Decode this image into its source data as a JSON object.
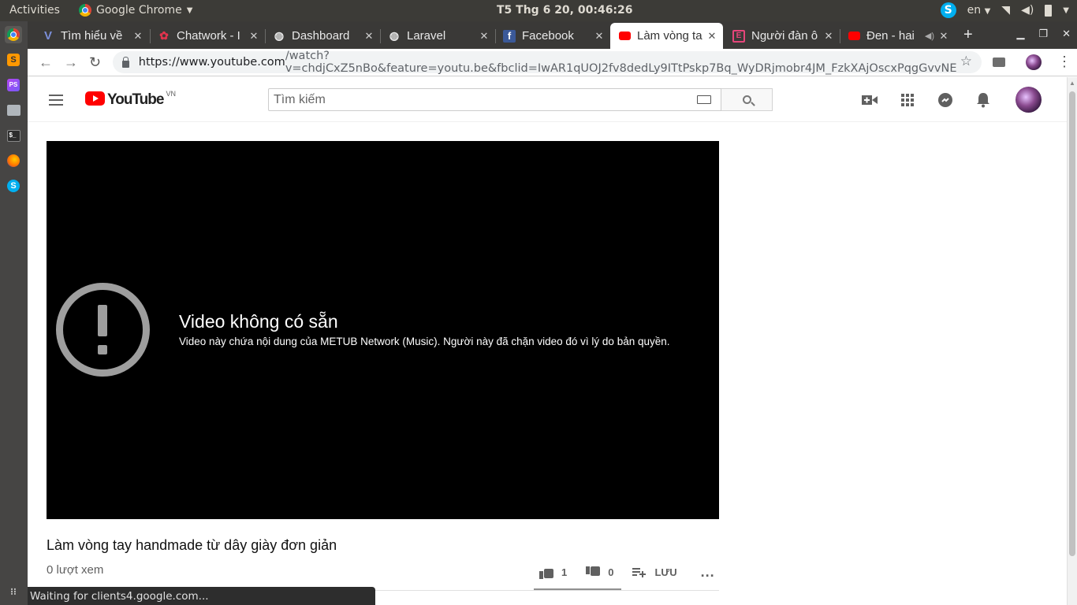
{
  "system": {
    "activities": "Activities",
    "app_name": "Google Chrome",
    "clock": "T5 Thg 6 20, 00:46:26",
    "keyboard_layout": "en"
  },
  "tabs": [
    {
      "label": "Tìm hiểu về",
      "icon": "v-icon",
      "active": false
    },
    {
      "label": "Chatwork - I",
      "icon": "chatwork-icon",
      "active": false
    },
    {
      "label": "Dashboard",
      "icon": "globe-icon",
      "active": false
    },
    {
      "label": "Laravel",
      "icon": "globe-icon",
      "active": false
    },
    {
      "label": "Facebook",
      "icon": "facebook-icon",
      "active": false
    },
    {
      "label": "Làm vòng ta",
      "icon": "youtube-icon",
      "active": true
    },
    {
      "label": "Người đàn ô",
      "icon": "e-icon",
      "active": false
    },
    {
      "label": "Đen - hai",
      "icon": "youtube-icon",
      "active": false
    }
  ],
  "toolbar": {
    "url_host": "https://www.youtube.com",
    "url_rest": "/watch?v=chdjCxZ5nBo&feature=youtu.be&fbclid=IwAR1qUOJ2fv8dedLy9ITtPskp7Bq_WyDRjmobr4JM_FzkXAjOscxPqgGvvNE"
  },
  "youtube": {
    "logo_text": "YouTube",
    "country_code": "VN",
    "search_placeholder": "Tìm kiếm"
  },
  "player": {
    "error_title": "Video không có sẵn",
    "error_description": "Video này chứa nội dung của METUB Network (Music). Người này đã chặn video đó vì lý do bản quyền."
  },
  "video": {
    "title": "Làm vòng tay handmade từ dây giày đơn giản",
    "views": "0 lượt xem",
    "likes": "1",
    "dislikes": "0",
    "save_label": "LƯU",
    "more_label": "..."
  },
  "status_text": "Waiting for clients4.google.com...",
  "colors": {
    "youtube_red": "#ff0000",
    "player_bg": "#000000",
    "error_icon": "#9e9e9e"
  }
}
